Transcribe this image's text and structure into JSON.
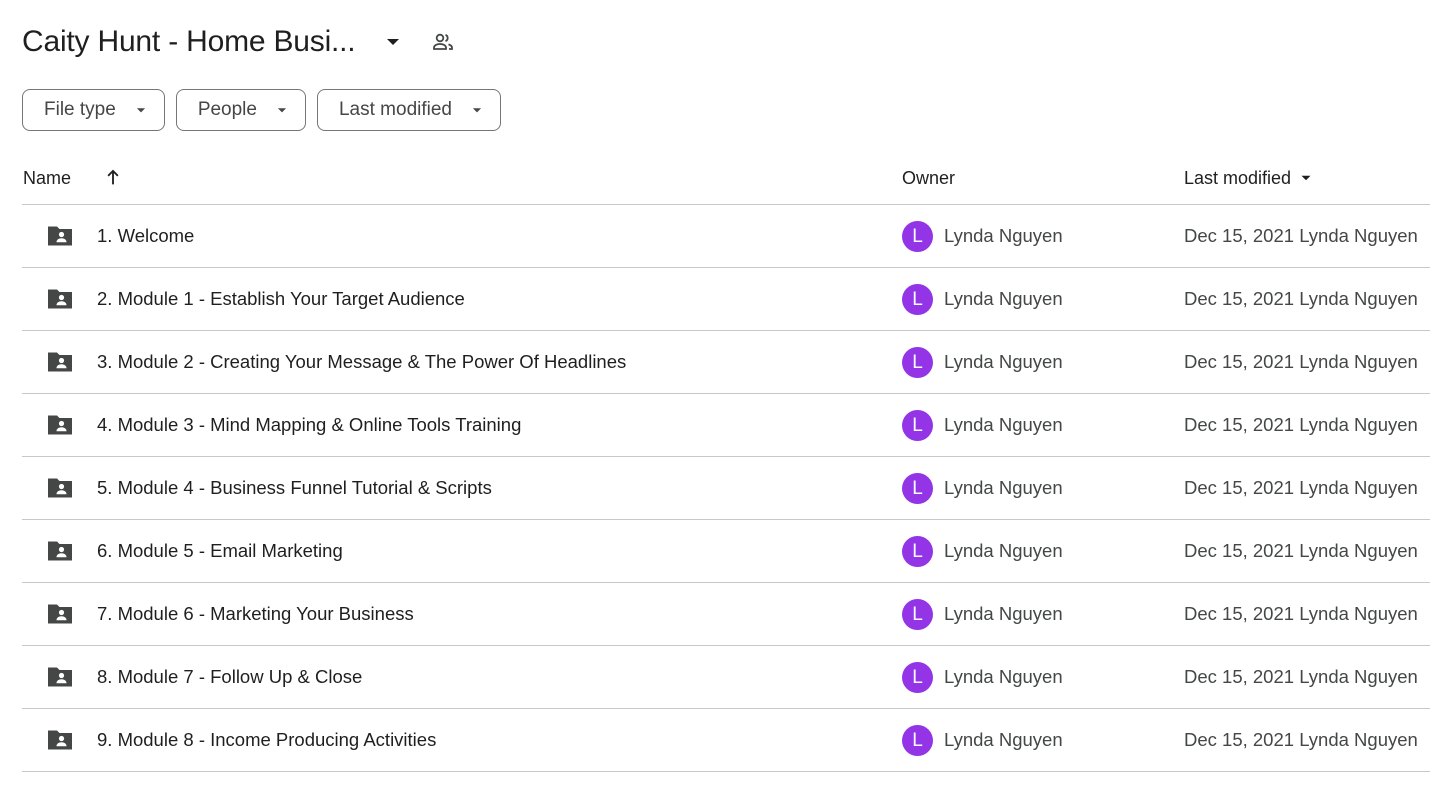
{
  "header": {
    "title": "Caity Hunt - Home Busi...",
    "caret_icon": "arrow-drop-down-icon",
    "shared_icon": "people-icon"
  },
  "filters": [
    {
      "label": "File type"
    },
    {
      "label": "People"
    },
    {
      "label": "Last modified"
    }
  ],
  "columns": {
    "name": "Name",
    "owner": "Owner",
    "modified": "Last modified",
    "name_sort_icon": "arrow-upward-icon",
    "modified_sort_icon": "arrow-drop-down-icon"
  },
  "colors": {
    "avatar": "#9334e6",
    "folder_icon": "#444746"
  },
  "rows": [
    {
      "name": "1. Welcome",
      "owner": "Lynda Nguyen",
      "avatar_letter": "L",
      "modified": "Dec 15, 2021 Lynda Nguyen"
    },
    {
      "name": "2. Module 1 - Establish Your Target Audience",
      "owner": "Lynda Nguyen",
      "avatar_letter": "L",
      "modified": "Dec 15, 2021 Lynda Nguyen"
    },
    {
      "name": "3. Module 2 - Creating Your Message & The Power Of Headlines",
      "owner": "Lynda Nguyen",
      "avatar_letter": "L",
      "modified": "Dec 15, 2021 Lynda Nguyen"
    },
    {
      "name": "4. Module 3 - Mind Mapping & Online Tools Training",
      "owner": "Lynda Nguyen",
      "avatar_letter": "L",
      "modified": "Dec 15, 2021 Lynda Nguyen"
    },
    {
      "name": "5. Module 4 - Business Funnel Tutorial & Scripts",
      "owner": "Lynda Nguyen",
      "avatar_letter": "L",
      "modified": "Dec 15, 2021 Lynda Nguyen"
    },
    {
      "name": "6. Module 5 - Email Marketing",
      "owner": "Lynda Nguyen",
      "avatar_letter": "L",
      "modified": "Dec 15, 2021 Lynda Nguyen"
    },
    {
      "name": "7. Module 6 - Marketing Your Business",
      "owner": "Lynda Nguyen",
      "avatar_letter": "L",
      "modified": "Dec 15, 2021 Lynda Nguyen"
    },
    {
      "name": "8. Module 7 - Follow Up & Close",
      "owner": "Lynda Nguyen",
      "avatar_letter": "L",
      "modified": "Dec 15, 2021 Lynda Nguyen"
    },
    {
      "name": "9. Module 8 - Income Producing Activities",
      "owner": "Lynda Nguyen",
      "avatar_letter": "L",
      "modified": "Dec 15, 2021 Lynda Nguyen"
    }
  ]
}
